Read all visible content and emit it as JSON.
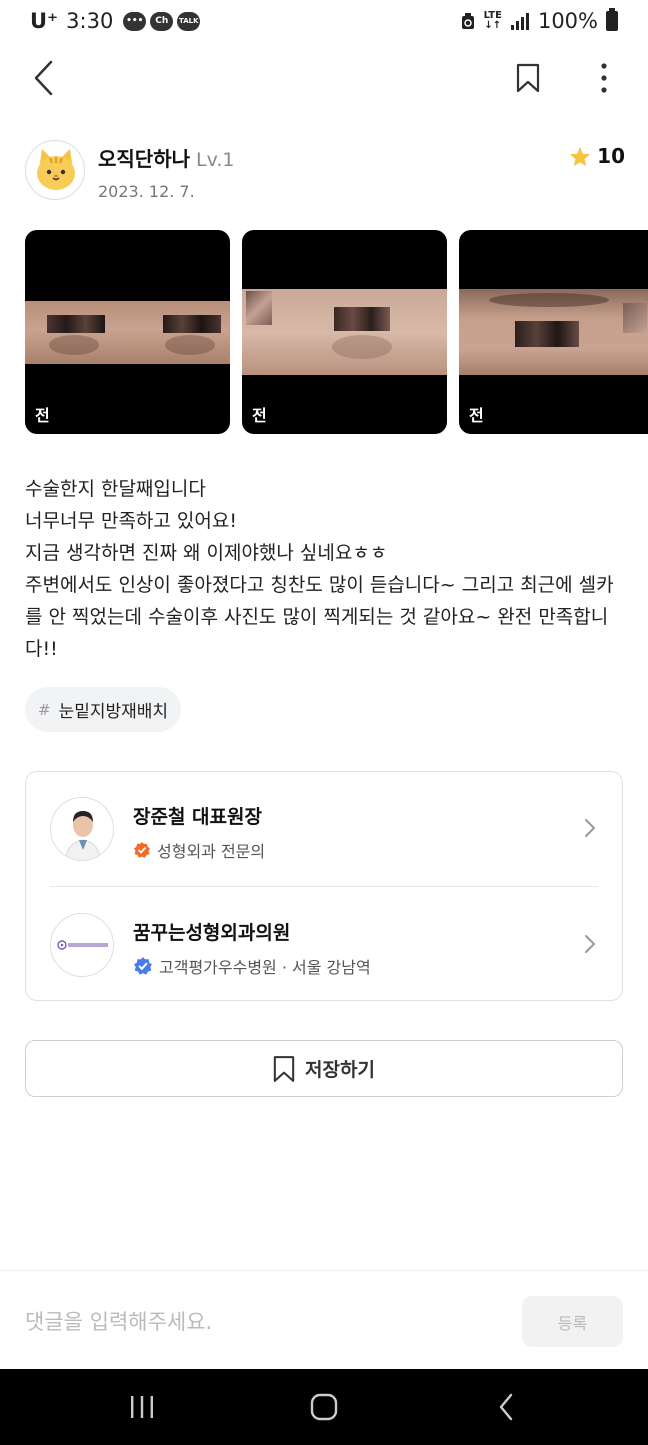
{
  "status_bar": {
    "carrier": "U⁺",
    "time": "3:30",
    "notif_ch": "Ch",
    "notif_talk": "TALK",
    "lte": "LTE",
    "battery": "100%"
  },
  "toolbar": {
    "back_icon": "chevron-left-icon",
    "bookmark_icon": "bookmark-icon",
    "more_icon": "more-vertical-icon"
  },
  "author": {
    "name": "오직단하나",
    "level": "Lv.1",
    "date": "2023. 12. 7.",
    "rating": "10",
    "rating_color": "#f6c343"
  },
  "photos": [
    {
      "label": "전"
    },
    {
      "label": "전"
    },
    {
      "label": "전"
    }
  ],
  "post": {
    "body": "수술한지 한달째입니다\n너무너무 만족하고 있어요!\n지금 생각하면 진짜 왜 이제야했나 싶네요ㅎㅎ\n주변에서도 인상이 좋아졌다고 칭찬도 많이 듣습니다~ 그리고 최근에 셀카를 안 찍었는데 수술이후 사진도 많이 찍게되는 것 같아요~ 완전 만족합니다!!"
  },
  "tag": {
    "hash": "#",
    "label": "눈밑지방재배치"
  },
  "doctor": {
    "name": "장준철 대표원장",
    "specialty": "성형외과 전문의",
    "badge_color": "#f06a28"
  },
  "hospital": {
    "name": "꿈꾸는성형외과의원",
    "info": "고객평가우수병원 · 서울 강남역",
    "logo_text": "꿈꾸는성형외과",
    "badge_color": "#4a7be8"
  },
  "save_button": {
    "label": "저장하기"
  },
  "comment": {
    "placeholder": "댓글을 입력해주세요.",
    "submit_label": "등록"
  },
  "nav": {
    "recent_icon": "recent-apps-icon",
    "home_icon": "home-icon",
    "back_icon": "back-icon"
  }
}
